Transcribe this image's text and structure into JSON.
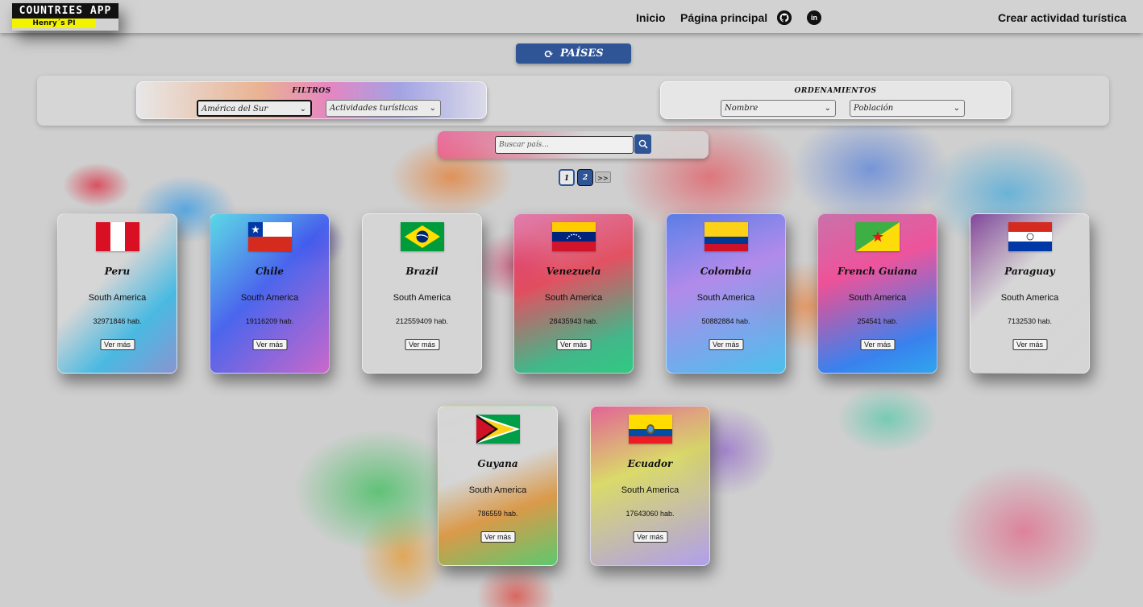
{
  "header": {
    "logo_title": "COUNTRIES APP",
    "logo_subtitle": "Henry´s PI",
    "nav": {
      "home": "Inicio",
      "main_page": "Página principal",
      "create_activity": "Crear actividad turística"
    },
    "icons": [
      "github-icon",
      "linkedin-icon"
    ]
  },
  "countries_button": "PAÍSES",
  "filters": {
    "title": "FILTROS",
    "continent_selected": "América del Sur",
    "activity_selected": "Actividades turísticas"
  },
  "sorts": {
    "title": "ORDENAMIENTOS",
    "name_selected": "Nombre",
    "population_selected": "Población"
  },
  "search": {
    "placeholder": "Buscar país..."
  },
  "pagination": {
    "current": "1",
    "pages": [
      "1",
      "2"
    ],
    "next": ">>"
  },
  "cards": [
    {
      "name": "Peru",
      "continent": "South America",
      "population": "32971846 hab.",
      "more": "Ver más"
    },
    {
      "name": "Chile",
      "continent": "South America",
      "population": "19116209 hab.",
      "more": "Ver más"
    },
    {
      "name": "Brazil",
      "continent": "South America",
      "population": "212559409 hab.",
      "more": "Ver más"
    },
    {
      "name": "Venezuela",
      "continent": "South America",
      "population": "28435943 hab.",
      "more": "Ver más"
    },
    {
      "name": "Colombia",
      "continent": "South America",
      "population": "50882884 hab.",
      "more": "Ver más"
    },
    {
      "name": "French Guiana",
      "continent": "South America",
      "population": "254541 hab.",
      "more": "Ver más"
    },
    {
      "name": "Paraguay",
      "continent": "South America",
      "population": "7132530 hab.",
      "more": "Ver más"
    },
    {
      "name": "Guyana",
      "continent": "South America",
      "population": "786559 hab.",
      "more": "Ver más"
    },
    {
      "name": "Ecuador",
      "continent": "South America",
      "population": "17643060 hab.",
      "more": "Ver más"
    }
  ],
  "colors": {
    "accent_blue": "#2f5597",
    "logo_yellow": "#f3f300"
  }
}
